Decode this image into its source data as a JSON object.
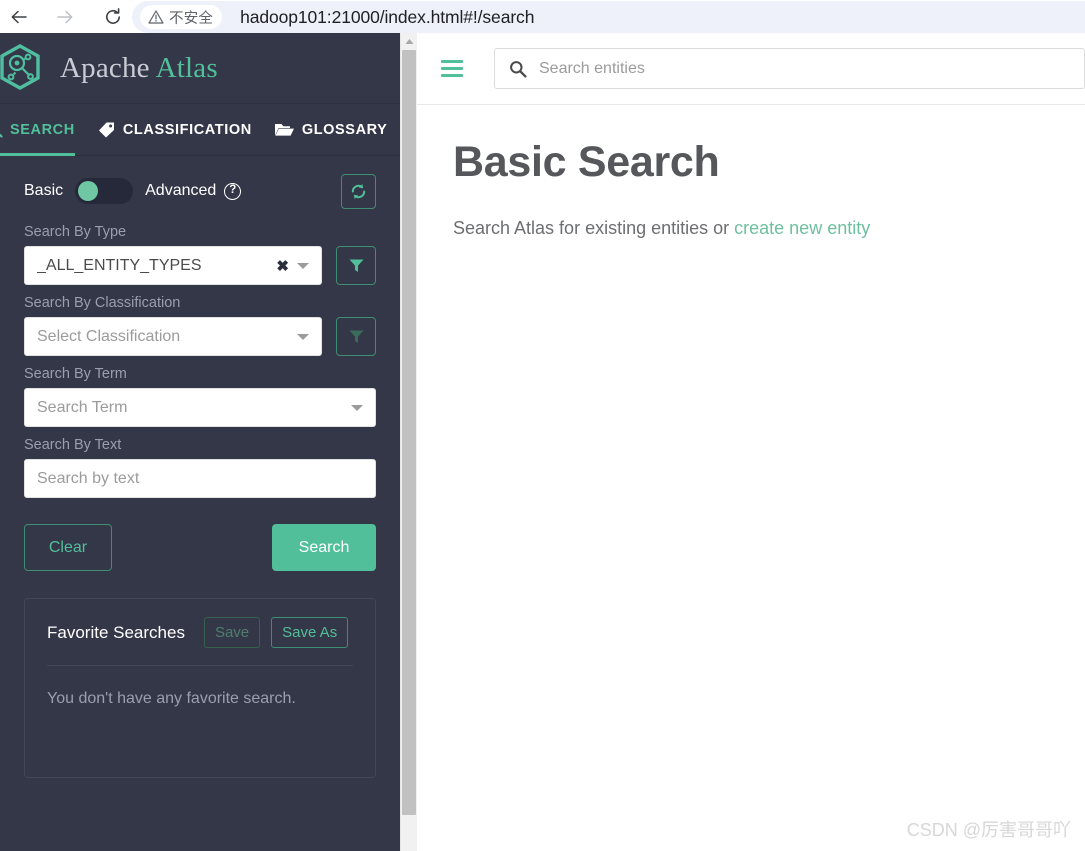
{
  "browser": {
    "back_icon": "back-arrow-icon",
    "forward_icon": "forward-arrow-icon",
    "reload_icon": "reload-icon",
    "security_icon": "warning-triangle-icon",
    "security_label": "不安全",
    "url": "hadoop101:21000/index.html#!/search"
  },
  "sidebar": {
    "brand": {
      "logo_icon": "atlas-hexagon-logo-icon",
      "name_primary": "Apache",
      "name_accent": "Atlas"
    },
    "tabs": [
      {
        "label": "SEARCH",
        "icon": "magnifier-icon",
        "active": true
      },
      {
        "label": "CLASSIFICATION",
        "icon": "tag-icon",
        "active": false
      },
      {
        "label": "GLOSSARY",
        "icon": "folder-open-icon",
        "active": false
      }
    ],
    "mode": {
      "basic_label": "Basic",
      "advanced_label": "Advanced",
      "help_glyph": "?",
      "toggle_state": "basic",
      "refresh_icon": "refresh-icon"
    },
    "fields": [
      {
        "label": "Search By Type",
        "value": "_ALL_ENTITY_TYPES",
        "is_placeholder": false,
        "has_clear": true,
        "clear_glyph": "✖",
        "has_filter": true,
        "filter_enabled": true,
        "filter_icon": "filter-funnel-icon"
      },
      {
        "label": "Search By Classification",
        "value": "Select Classification",
        "is_placeholder": true,
        "has_clear": false,
        "has_filter": true,
        "filter_enabled": false,
        "filter_icon": "filter-funnel-icon"
      },
      {
        "label": "Search By Term",
        "value": "Search Term",
        "is_placeholder": true,
        "has_clear": false,
        "has_filter": false
      }
    ],
    "text_field": {
      "label": "Search By Text",
      "placeholder": "Search by text",
      "value": ""
    },
    "actions": {
      "clear_label": "Clear",
      "search_label": "Search"
    },
    "favorites": {
      "title": "Favorite Searches",
      "save_label": "Save",
      "save_as_label": "Save As",
      "empty_message": "You don't have any favorite search."
    }
  },
  "main": {
    "menu_icon": "hamburger-menu-icon",
    "entity_search": {
      "icon": "search-icon",
      "placeholder": "Search entities",
      "value": ""
    },
    "title": "Basic Search",
    "subtitle_prefix": "Search Atlas for existing entities or ",
    "subtitle_link": "create new entity"
  },
  "watermark": "CSDN @厉害哥哥吖",
  "colors": {
    "sidebar_bg": "#343747",
    "accent_green": "#52bf9b",
    "title_grey": "#56575a",
    "link_green": "#6fbfa0"
  }
}
